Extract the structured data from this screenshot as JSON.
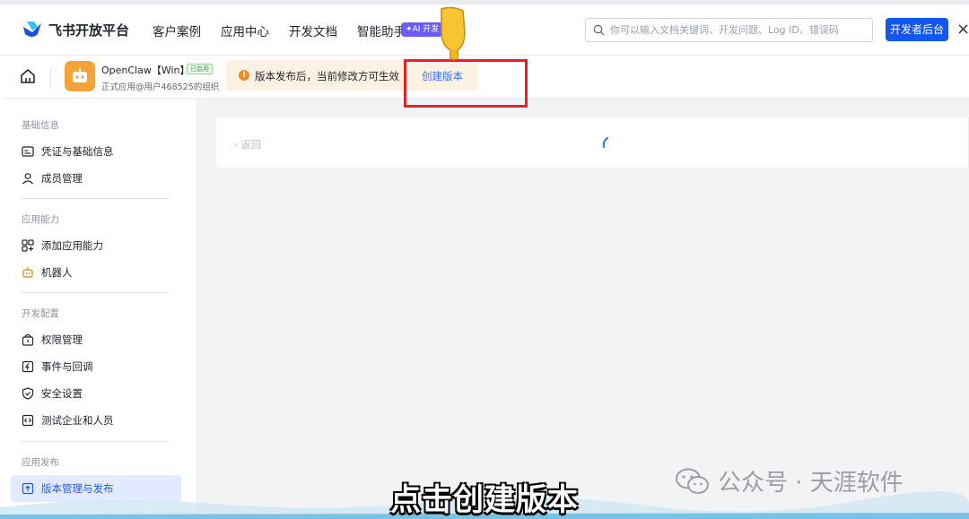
{
  "topbar": {
    "brand": "飞书开放平台",
    "nav": [
      "客户案例",
      "应用中心",
      "开发文档",
      "智能助手"
    ],
    "ai_badge": "✦AI 开发",
    "search_placeholder": "你可以输入文档关键词、开发问题、Log ID、错误码",
    "dev_console": "开发者后台",
    "close_glyph": "×"
  },
  "app": {
    "name": "OpenClaw【Win】",
    "status": "已启用",
    "subtitle": "正式应用@用户468525的组织",
    "notice": "版本发布后，当前修改方可生效",
    "notice_icon": "!",
    "create_version": "创建版本"
  },
  "sidebar": {
    "sections": [
      {
        "title": "基础信息",
        "items": [
          {
            "label": "凭证与基础信息",
            "icon": "credential-icon"
          },
          {
            "label": "成员管理",
            "icon": "member-icon"
          }
        ]
      },
      {
        "title": "应用能力",
        "items": [
          {
            "label": "添加应用能力",
            "icon": "add-capability-icon"
          },
          {
            "label": "机器人",
            "icon": "robot-icon"
          }
        ]
      },
      {
        "title": "开发配置",
        "items": [
          {
            "label": "权限管理",
            "icon": "permission-icon"
          },
          {
            "label": "事件与回调",
            "icon": "event-icon"
          },
          {
            "label": "安全设置",
            "icon": "shield-icon"
          },
          {
            "label": "测试企业和人员",
            "icon": "test-icon"
          }
        ]
      },
      {
        "title": "应用发布",
        "items": [
          {
            "label": "版本管理与发布",
            "icon": "publish-icon"
          }
        ]
      }
    ]
  },
  "main": {
    "back": "‹ 返回"
  },
  "overlay": {
    "subtitle": "点击创建版本",
    "watermark": "公众号 · 天涯软件"
  },
  "colors": {
    "accent": "#1456f0",
    "link": "#3370ff",
    "notice_bg": "#fdf1e4",
    "highlight": "#e4202a",
    "avatar": "#f4a23a"
  }
}
